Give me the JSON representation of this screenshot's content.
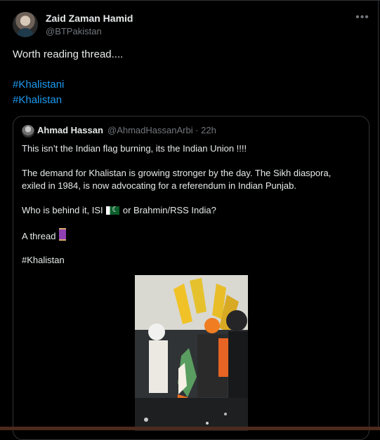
{
  "post": {
    "author_name": "Zaid Zaman Hamid",
    "author_handle": "@BTPakistan",
    "more_icon": "more-horizontal-icon",
    "text": "Worth reading thread....",
    "hashtags": [
      "#Khalistani",
      "#Khalistan"
    ]
  },
  "quote": {
    "author_name": "Ahmad Hassan",
    "author_handle_time": "@AhmadHassanArbi · 22h",
    "lines": [
      "This isn’t the Indian flag burning, its the Indian Union !!!!",
      "The demand for Khalistan is growing stronger by the day. The Sikh diaspora,",
      "exiled in 1984, is now advocating for a referendum in Indian Punjab.",
      "Who is behind it, ISI",
      "or Brahmin/RSS India?",
      "A thread",
      "#Khalistan"
    ],
    "icons": [
      "pakistan-flag-icon",
      "thread-spool-icon"
    ]
  },
  "colors": {
    "background": "#000000",
    "text": "#e7e9ea",
    "secondary": "#71767b",
    "link": "#1d9bf0",
    "border": "#2f3336"
  }
}
